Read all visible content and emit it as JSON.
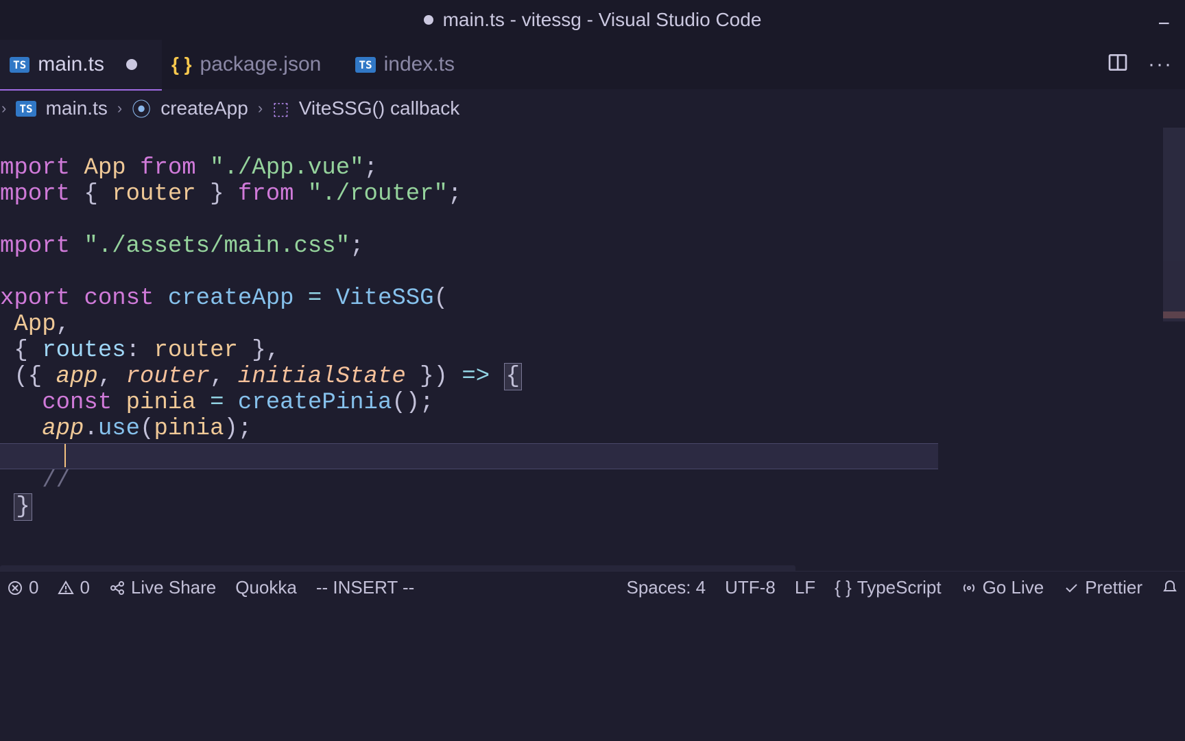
{
  "title_bar": {
    "text": "main.ts - vitessg - Visual Studio Code"
  },
  "tabs": [
    {
      "label": "main.ts",
      "active": true,
      "dirty": true,
      "icon": "ts"
    },
    {
      "label": "package.json",
      "active": false,
      "dirty": false,
      "icon": "braces"
    },
    {
      "label": "index.ts",
      "active": false,
      "dirty": false,
      "icon": "ts"
    }
  ],
  "breadcrumb": [
    {
      "icon": "ts",
      "label": "main.ts"
    },
    {
      "icon": "func",
      "label": "createApp"
    },
    {
      "icon": "cube",
      "label": "ViteSSG() callback"
    }
  ],
  "code": {
    "l1_kw": "mport",
    "l1_var": "App",
    "l1_from": "from",
    "l1_str": "\"./App.vue\"",
    "l2_kw": "mport",
    "l2_pun1": "{ ",
    "l2_var": "router",
    "l2_pun2": " }",
    "l2_from": "from",
    "l2_str": "\"./router\"",
    "l3_kw": "mport",
    "l3_str": "\"./assets/main.css\"",
    "l4_kw": "xport",
    "l4_const": "const",
    "l4_fn": "createApp",
    "l4_eq": "=",
    "l4_call": "ViteSSG",
    "l5_var": "App",
    "l6_pun1": "{ ",
    "l6_prop": "routes",
    "l6_colon": ":",
    "l6_var": "router",
    "l6_pun2": " },",
    "l7_pun1": "({ ",
    "l7_a": "app",
    "l7_c1": ", ",
    "l7_r": "router",
    "l7_c2": ", ",
    "l7_i": "initialState",
    "l7_pun2": " })",
    "l7_arrow": "=>",
    "l7_brace": "{",
    "l8_const": "const",
    "l8_var": "pinia",
    "l8_eq": "=",
    "l8_fn": "createPinia",
    "l8_call": "();",
    "l9_obj": "app",
    "l9_dot": ".",
    "l9_fn": "use",
    "l9_open": "(",
    "l9_arg": "pinia",
    "l9_close": ");",
    "l10_com": "// ",
    "l11_brace": "}"
  },
  "status": {
    "errors": "0",
    "warnings": "0",
    "live_share": "Live Share",
    "quokka": "Quokka",
    "vim_mode": "-- INSERT --",
    "spaces": "Spaces: 4",
    "encoding": "UTF-8",
    "eol": "LF",
    "language": "TypeScript",
    "go_live": "Go Live",
    "prettier": "Prettier"
  }
}
